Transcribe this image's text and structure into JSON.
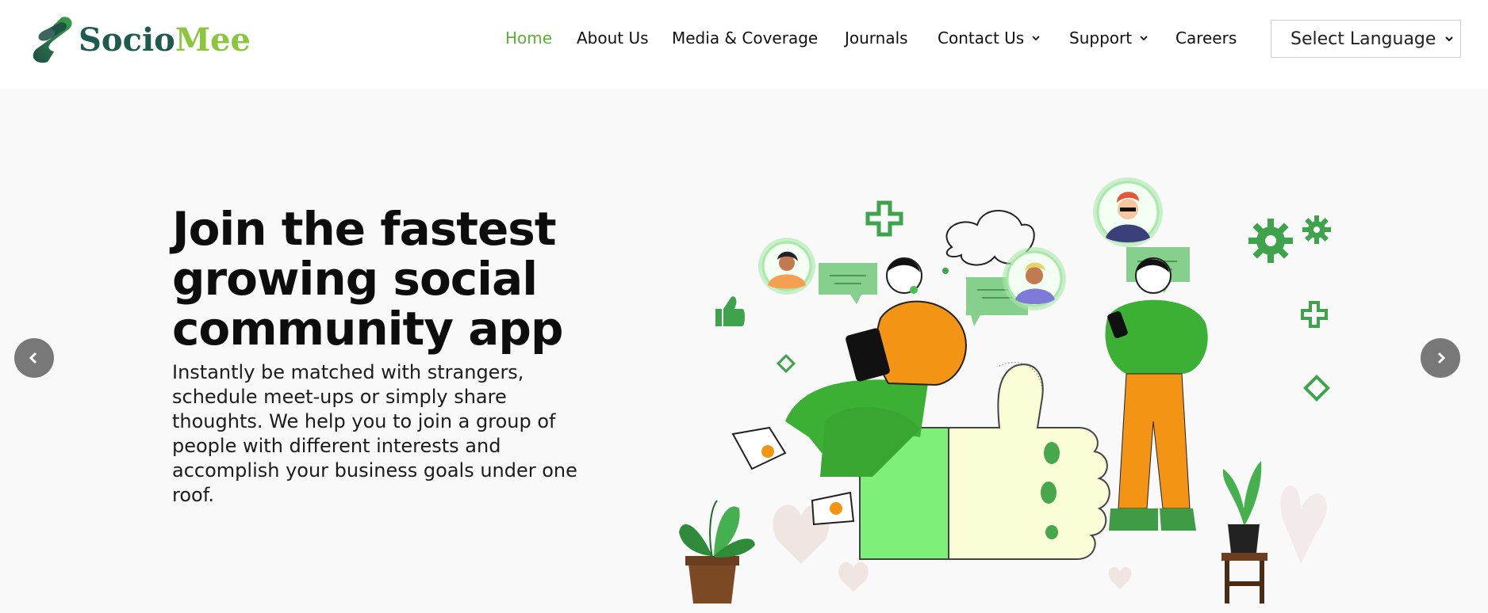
{
  "brand": {
    "name_part1": "Socio",
    "name_part2": "Mee",
    "colors": {
      "dark": "#1f5a4e",
      "accent": "#8cc63f",
      "nav_active": "#5cb135"
    }
  },
  "nav": {
    "items": [
      {
        "label": "Home",
        "active": true
      },
      {
        "label": "About Us"
      },
      {
        "label": "Media & Coverage"
      },
      {
        "label": "Journals"
      },
      {
        "label": "Contact Us",
        "dropdown": true
      },
      {
        "label": "Support",
        "dropdown": true
      },
      {
        "label": "Careers"
      }
    ]
  },
  "language_select": {
    "value": "Select Language",
    "icon": "chevron-down-icon"
  },
  "hero": {
    "headline": "Join the fastest growing social community app",
    "subtext": "Instantly be matched with strangers, schedule meet-ups or simply share thoughts. We help you to join a group of people with different interests and accomplish your business goals under one roof.",
    "prev_icon": "chevron-left-icon",
    "next_icon": "chevron-right-icon",
    "illustration": "thumbs-up-community-illustration"
  }
}
